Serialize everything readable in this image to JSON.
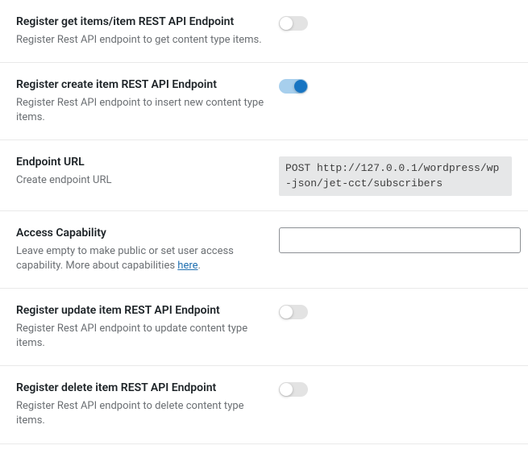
{
  "rows": {
    "get_items": {
      "title": "Register get items/item REST API Endpoint",
      "desc": "Register Rest API endpoint to get content type items.",
      "enabled": false
    },
    "create_item": {
      "title": "Register create item REST API Endpoint",
      "desc": "Register Rest API endpoint to insert new content type items.",
      "enabled": true
    },
    "endpoint_url": {
      "title": "Endpoint URL",
      "desc": "Create endpoint URL",
      "value": "POST http://127.0.0.1/wordpress/wp-json/jet-cct/subscribers"
    },
    "access_capability": {
      "title": "Access Capability",
      "desc_pre": "Leave empty to make public or set user access capability. More about capabilities ",
      "link_text": "here",
      "desc_post": ".",
      "value": ""
    },
    "update_item": {
      "title": "Register update item REST API Endpoint",
      "desc": "Register Rest API endpoint to update content type items.",
      "enabled": false
    },
    "delete_item": {
      "title": "Register delete item REST API Endpoint",
      "desc": "Register Rest API endpoint to delete content type items.",
      "enabled": false
    }
  }
}
